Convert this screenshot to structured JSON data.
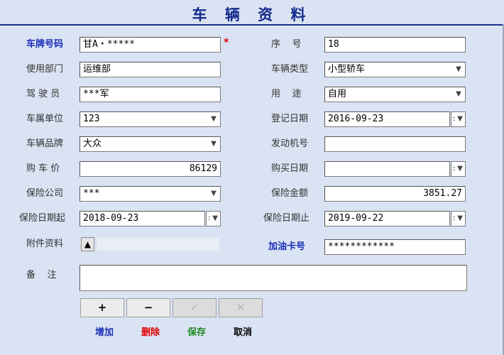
{
  "title": "车 辆 资 料",
  "fields": {
    "plate": {
      "label": "车牌号码",
      "value": "甘A・*****"
    },
    "serial": {
      "label": "序    号",
      "value": "18"
    },
    "dept": {
      "label": "使用部门",
      "value": "运维部"
    },
    "vehicle_type": {
      "label": "车辆类型",
      "value": "小型轿车"
    },
    "driver": {
      "label": "驾 驶 员",
      "value": "***军"
    },
    "usage": {
      "label": "用    途",
      "value": "自用"
    },
    "owner_unit": {
      "label": "车属单位",
      "value": "123"
    },
    "reg_date": {
      "label": "登记日期",
      "value": "2016-09-23"
    },
    "brand": {
      "label": "车辆品牌",
      "value": "大众"
    },
    "engine_no": {
      "label": "发动机号",
      "value": ""
    },
    "price": {
      "label": "购 车 价",
      "value": "86129"
    },
    "purchase_date": {
      "label": "购买日期",
      "value": ""
    },
    "insurer": {
      "label": "保险公司",
      "value": "***"
    },
    "insurance_amount": {
      "label": "保险金额",
      "value": "3851.27"
    },
    "ins_start": {
      "label": "保险日期起",
      "value": "2018-09-23"
    },
    "ins_end": {
      "label": "保险日期止",
      "value": "2019-09-22"
    },
    "attachment": {
      "label": "附件资料"
    },
    "fuel_card": {
      "label": "加油卡号",
      "value": "************"
    },
    "memo": {
      "label": "备    注",
      "value": ""
    }
  },
  "required_mark": "*",
  "buttons": {
    "add": {
      "symbol": "+",
      "label": "增加",
      "color": "#1a2fb8"
    },
    "delete": {
      "symbol": "−",
      "label": "删除",
      "color": "#e00000"
    },
    "save": {
      "symbol": "✓",
      "label": "保存",
      "color": "#1e8a1e"
    },
    "cancel": {
      "symbol": "✕",
      "label": "取消",
      "color": "#000000"
    }
  },
  "icons": {
    "dropdown": "chevron-down-icon",
    "spinner": "spinner-icon",
    "attach": "triangle-up-icon"
  }
}
